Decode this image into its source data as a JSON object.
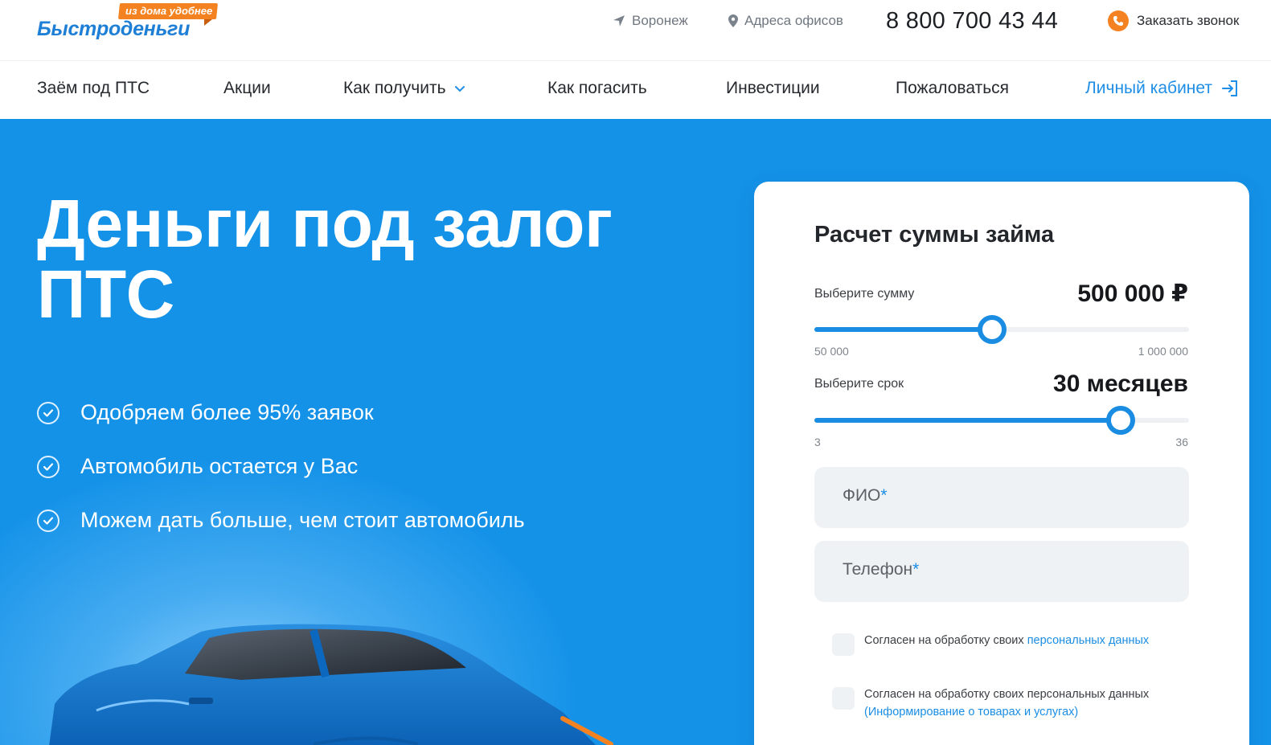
{
  "brand": {
    "name": "Быстроденьги",
    "tagline": "из дома удобнее",
    "accent": "#1492e8",
    "orange": "#f58220"
  },
  "topbar": {
    "city": "Воронеж",
    "offices": "Адреса офисов",
    "phone": "8 800 700 43 44",
    "callback": "Заказать звонок"
  },
  "nav": {
    "items": [
      {
        "label": "Заём под ПТС"
      },
      {
        "label": "Акции"
      },
      {
        "label": "Как получить"
      },
      {
        "label": "Как погасить"
      },
      {
        "label": "Инвестиции"
      },
      {
        "label": "Пожаловаться"
      }
    ],
    "cabinet": "Личный кабинет"
  },
  "hero": {
    "title": "Деньги под залог ПТС",
    "features": [
      "Одобряем более 95% заявок",
      "Автомобиль остается у Вас",
      "Можем дать больше, чем стоит автомобиль"
    ]
  },
  "calculator": {
    "title": "Расчет суммы займа",
    "amount": {
      "label": "Выберите сумму",
      "value_text": "500 000 ₽",
      "min_text": "50 000",
      "max_text": "1 000 000",
      "value": 500000,
      "min": 50000,
      "max": 1000000
    },
    "term": {
      "label": "Выберите срок",
      "value_text": "30 месяцев",
      "min_text": "3",
      "max_text": "36",
      "value": 30,
      "min": 3,
      "max": 36
    },
    "fields": {
      "name": {
        "label": "ФИО",
        "required": "*",
        "value": ""
      },
      "phone": {
        "label": "Телефон",
        "required": "*",
        "value": ""
      }
    },
    "consents": [
      {
        "text": "Согласен на обработку своих ",
        "link": "персональных данных",
        "checked": false
      },
      {
        "text": "Согласен на обработку своих персональных данных ",
        "link": "(Информирование о товарах и услугах)",
        "checked": false
      }
    ]
  }
}
